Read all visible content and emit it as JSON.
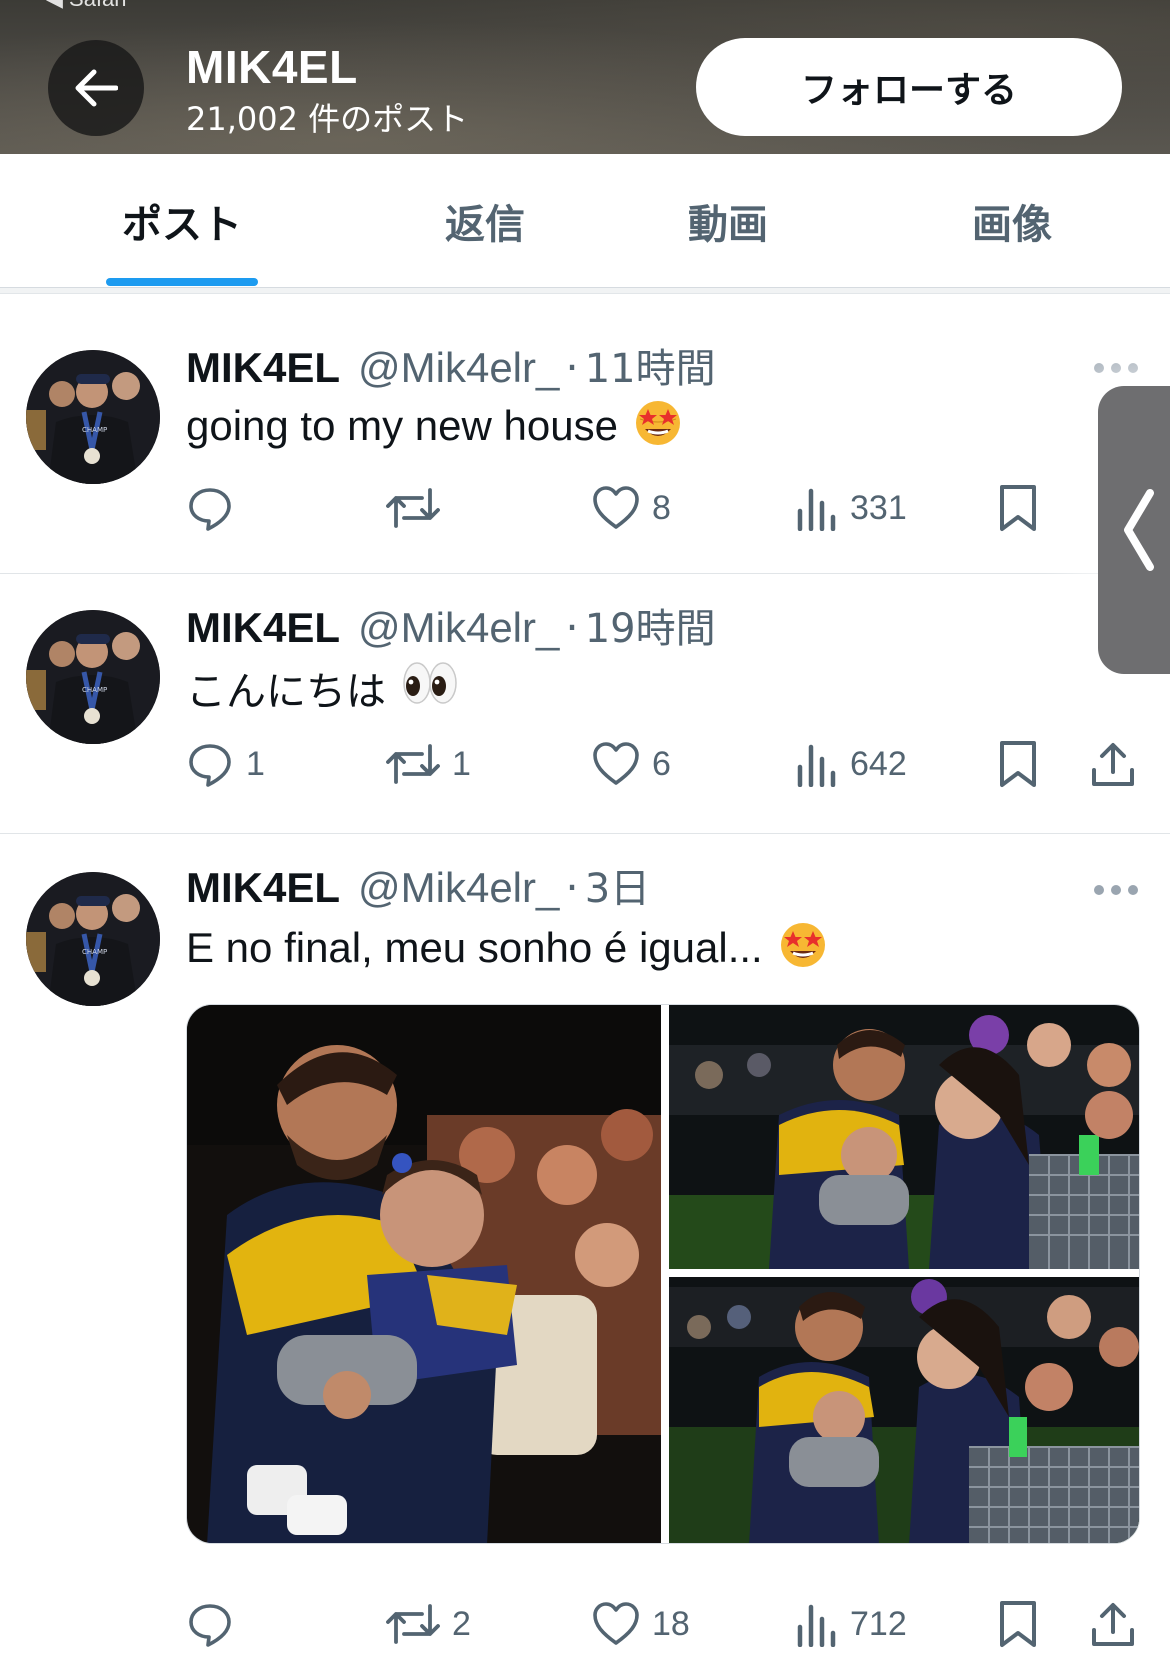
{
  "browser": {
    "return_label": "◀ Safari"
  },
  "header": {
    "name": "MIK4EL",
    "post_count": "21,002 件のポスト",
    "follow_label": "フォローする"
  },
  "tabs": [
    {
      "label": "ポスト",
      "active": true
    },
    {
      "label": "返信",
      "active": false
    },
    {
      "label": "動画",
      "active": false
    },
    {
      "label": "画像",
      "active": false
    }
  ],
  "tweets": [
    {
      "name": "MIK4EL",
      "handle": "@Mik4elr_",
      "dot": "·",
      "time": "11時間",
      "text": "going to my new house",
      "emoji": "star-struck",
      "replies": "",
      "retweets": "",
      "likes": "8",
      "views": "331"
    },
    {
      "name": "MIK4EL",
      "handle": "@Mik4elr_",
      "dot": "·",
      "time": "19時間",
      "text": "こんにちは",
      "emoji": "eyes",
      "replies": "1",
      "retweets": "1",
      "likes": "6",
      "views": "642"
    },
    {
      "name": "MIK4EL",
      "handle": "@Mik4elr_",
      "dot": "·",
      "time": "3日",
      "text": "E no final, meu sonho é igual...",
      "emoji": "star-struck",
      "media_count": 3,
      "replies": "",
      "retweets": "2",
      "likes": "18",
      "views": "712"
    }
  ],
  "colors": {
    "accent": "#1d9bf0",
    "text_primary": "#0f1419",
    "text_secondary": "#536471",
    "header_bg": "#4a4843"
  },
  "icons": [
    "back-arrow-icon",
    "more-icon",
    "reply-icon",
    "retweet-icon",
    "like-icon",
    "views-icon",
    "bookmark-icon",
    "share-icon",
    "chevron-left-icon"
  ]
}
